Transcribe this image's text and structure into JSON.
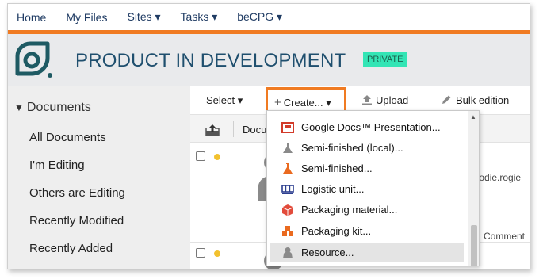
{
  "topnav": {
    "items": [
      "Home",
      "My Files",
      "Sites ▾",
      "Tasks ▾",
      "beCPG ▾"
    ]
  },
  "site": {
    "title": "PRODUCT IN DEVELOPMENT",
    "badge": "PRIVATE"
  },
  "sidebar": {
    "title": "Documents",
    "items": [
      "All Documents",
      "I'm Editing",
      "Others are Editing",
      "Recently Modified",
      "Recently Added"
    ]
  },
  "toolbar": {
    "select_label": "Select ▾",
    "create_label": "Create... ▾",
    "upload_label": "Upload",
    "bulk_label": "Bulk edition"
  },
  "list": {
    "column_header": "Docu",
    "row1_owner": "elodie.rogie",
    "row1_action": "Comment"
  },
  "dropdown": {
    "items": [
      {
        "label": "Google Docs™ Presentation...",
        "icon": "presentation-icon"
      },
      {
        "label": "Semi-finished (local)...",
        "icon": "flask-gray-icon"
      },
      {
        "label": "Semi-finished...",
        "icon": "flask-orange-icon"
      },
      {
        "label": "Logistic unit...",
        "icon": "pallet-icon"
      },
      {
        "label": "Packaging material...",
        "icon": "box-icon"
      },
      {
        "label": "Packaging kit...",
        "icon": "boxes-icon"
      },
      {
        "label": "Resource...",
        "icon": "person-icon"
      }
    ],
    "selected_index": 6
  },
  "colors": {
    "accent": "#f07b22",
    "brand_teal": "#1e5a63",
    "badge": "#33e5b5"
  }
}
